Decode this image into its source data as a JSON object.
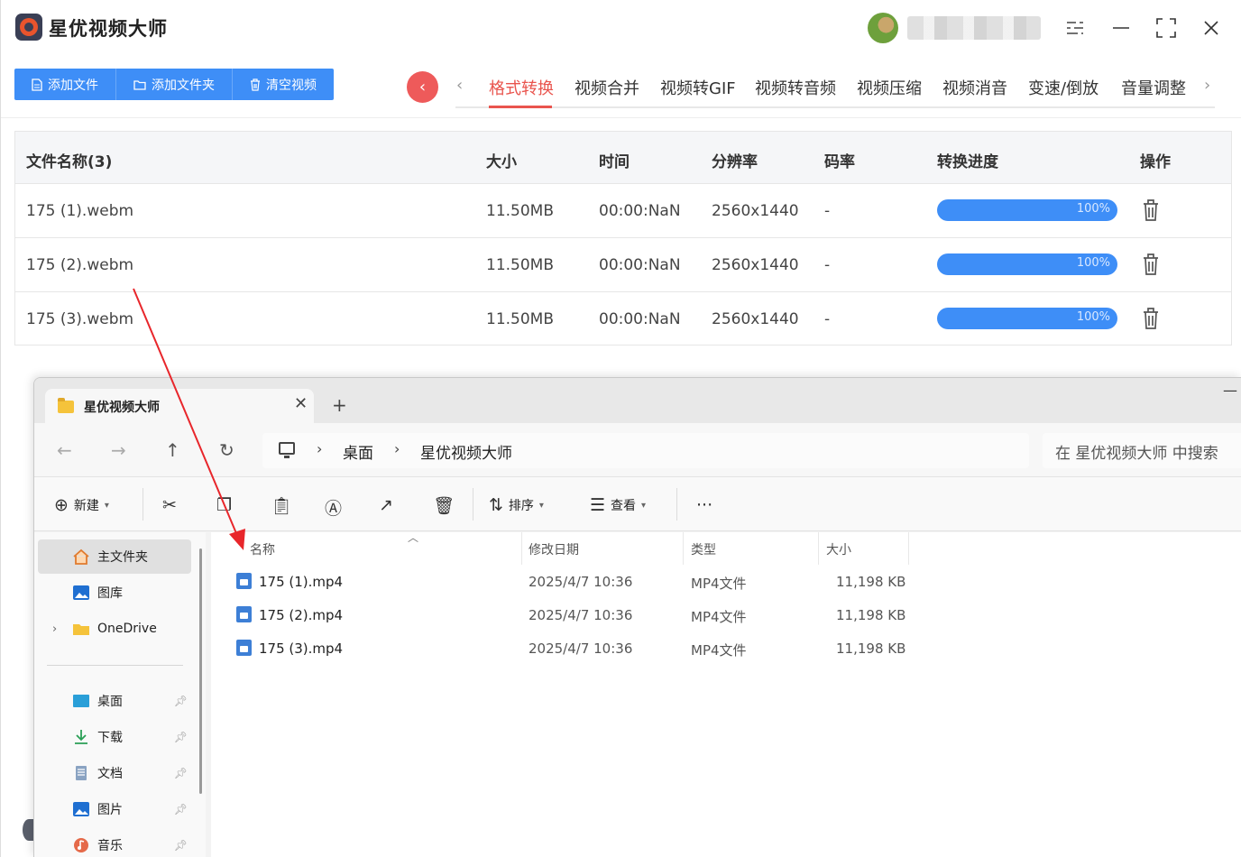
{
  "app": {
    "title": "星优视频大师",
    "toolbar": {
      "add_file": "添加文件",
      "add_folder": "添加文件夹",
      "clear_videos": "清空视频"
    },
    "tabs": [
      "格式转换",
      "视频合并",
      "视频转GIF",
      "视频转音频",
      "视频压缩",
      "视频消音",
      "变速/倒放",
      "音量调整"
    ],
    "active_tab": "格式转换",
    "table": {
      "headers": [
        "文件名称(3)",
        "大小",
        "时间",
        "分辨率",
        "码率",
        "转换进度",
        "操作"
      ],
      "rows": [
        {
          "name": "175 (1).webm",
          "size": "11.50MB",
          "time": "00:00:NaN",
          "resolution": "2560x1440",
          "bitrate": "-",
          "progress": 1.0,
          "progress_label": "100%"
        },
        {
          "name": "175 (2).webm",
          "size": "11.50MB",
          "time": "00:00:NaN",
          "resolution": "2560x1440",
          "bitrate": "-",
          "progress": 1.0,
          "progress_label": "100%"
        },
        {
          "name": "175 (3).webm",
          "size": "11.50MB",
          "time": "00:00:NaN",
          "resolution": "2560x1440",
          "bitrate": "-",
          "progress": 1.0,
          "progress_label": "100%"
        }
      ]
    },
    "colors": {
      "accent": "#3e8ef7",
      "active_tab": "#e9544d",
      "back_button": "#ee5a5a"
    }
  },
  "explorer": {
    "tab_title": "星优视频大师",
    "breadcrumb": [
      "桌面",
      "星优视频大师"
    ],
    "search_placeholder": "在 星优视频大师 中搜索",
    "commands": {
      "new": "新建",
      "sort": "排序",
      "view": "查看"
    },
    "nav": {
      "home": "主文件夹",
      "gallery": "图库",
      "onedrive": "OneDrive",
      "desktop": "桌面",
      "downloads": "下载",
      "documents": "文档",
      "pictures": "图片",
      "music": "音乐"
    },
    "columns": [
      "名称",
      "修改日期",
      "类型",
      "大小"
    ],
    "files": [
      {
        "name": "175 (1).mp4",
        "modified": "2025/4/7 10:36",
        "type": "MP4文件",
        "size": "11,198 KB"
      },
      {
        "name": "175 (2).mp4",
        "modified": "2025/4/7 10:36",
        "type": "MP4文件",
        "size": "11,198 KB"
      },
      {
        "name": "175 (3).mp4",
        "modified": "2025/4/7 10:36",
        "type": "MP4文件",
        "size": "11,198 KB"
      }
    ]
  }
}
